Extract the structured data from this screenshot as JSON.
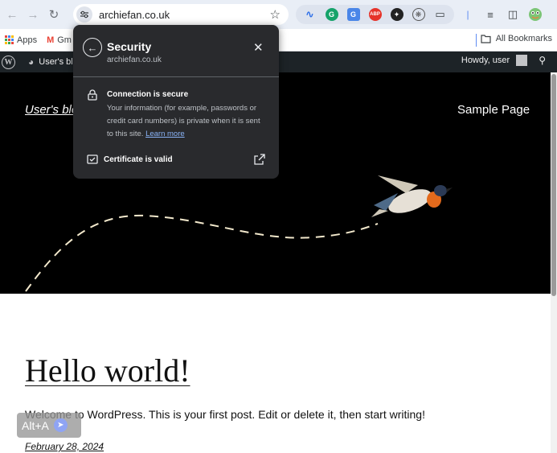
{
  "browser": {
    "url": "archiefan.co.uk",
    "bookmarks": {
      "apps": "Apps",
      "gmail": "Gm",
      "all": "All Bookmarks"
    }
  },
  "popup": {
    "title": "Security",
    "domain": "archiefan.co.uk",
    "connection_title": "Connection is secure",
    "connection_desc": "Your information (for example, passwords or credit card numbers) is private when it is sent to this site.",
    "learn_more": "Learn more",
    "certificate": "Certificate is valid"
  },
  "admin_bar": {
    "site_name": "User's blo",
    "howdy": "Howdy, user"
  },
  "site": {
    "title": "User's blo",
    "nav_item": "Sample Page"
  },
  "post": {
    "title": "Hello world!",
    "body": "Welcome to WordPress. This is your first post. Edit or delete it, then start writing!",
    "date": "February 28, 2024"
  },
  "overlay": {
    "label": "Alt+A"
  },
  "colors": {
    "toolbar": "#e9eef6",
    "popup_bg": "#292a2d",
    "link": "#8ab4f8",
    "admin_bar": "#1d2327",
    "hero": "#000000"
  }
}
